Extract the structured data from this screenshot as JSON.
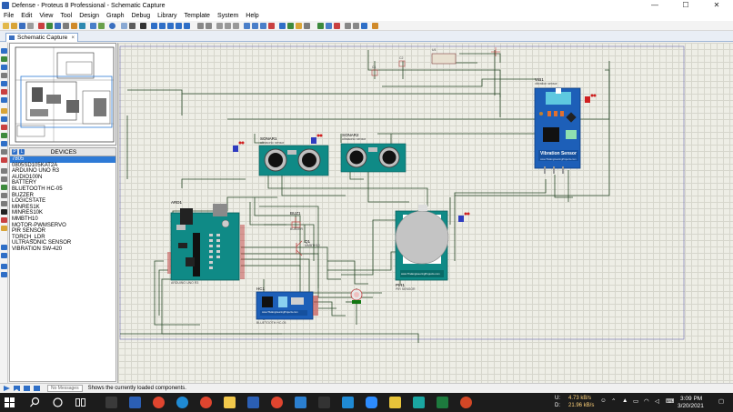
{
  "window": {
    "title": "Defense - Proteus 8 Professional - Schematic Capture",
    "controls": {
      "minimize": "—",
      "maximize": "☐",
      "close": "✕"
    }
  },
  "menu": [
    "File",
    "Edit",
    "View",
    "Tool",
    "Design",
    "Graph",
    "Debug",
    "Library",
    "Template",
    "System",
    "Help"
  ],
  "tab": {
    "label": "Schematic Capture",
    "close": "×"
  },
  "devices": {
    "header": "DEVICES",
    "pick_button": "P",
    "lib_button": "L",
    "items": [
      "7805",
      "0805SD105KAT2A",
      "ARDUINO UNO R3",
      "AUDIO100N",
      "BATTERY",
      "BLUETOOTH HC-05",
      "BUZZER",
      "LOGICSTATE",
      "MINRES1K",
      "MINRES10K",
      "MMBTH10",
      "MOTOR-PWMSERVO",
      "PIR SENSOR",
      "TORCH_LDR",
      "ULTRASONIC SENSOR",
      "VIBRATION SW-420"
    ],
    "selected_index": 0
  },
  "schematic": {
    "components": {
      "sonar1": {
        "ref": "SONAR1",
        "sub": "ultrasonic sensor"
      },
      "sonar2": {
        "ref": "SONAR2",
        "sub": "ultrasonic sensor"
      },
      "vib1": {
        "ref": "VIB1",
        "sub": "vibration sensor",
        "board_text": "Vibration Sensor",
        "site": "www.TheEngineeringProjects.com"
      },
      "ard1": {
        "ref": "ARD1",
        "sub": "ARDUINO UNO R3"
      },
      "buz1": {
        "ref": "BUZ1",
        "sub": "BUZZER"
      },
      "q1": {
        "ref": "Q1",
        "sub": "MMBTH10"
      },
      "pir1": {
        "ref": "PIR1",
        "sub": "PIR SENSOR",
        "site": "www.TheEngineeringProjects.com"
      },
      "hc1": {
        "ref": "HC1",
        "sub": "BLUETOOTH HC-05",
        "site": "www.TheEngineeringProjects.com"
      },
      "c1": {
        "ref": "C1"
      },
      "c2": {
        "ref": "C2"
      },
      "u1": {
        "ref": "U1"
      }
    }
  },
  "status": {
    "messages": "No Messages",
    "text": "Shows the currently loaded components."
  },
  "taskbar": {
    "net_up": "4.73 kB/s",
    "net_down": "21.96 kB/s",
    "up_label": "U:",
    "down_label": "D:",
    "time": "3:09 PM",
    "date": "3/20/2021"
  },
  "colors": {
    "canvas_bg": "#eeeee6",
    "wire": "#2a4a2a",
    "board_teal": "#0f8a86",
    "module_blue": "#1d5fb8",
    "selection_blue": "#2e7ad6",
    "taskbar": "#1c1c1c"
  },
  "icons": [
    "app-icon",
    "play-icon",
    "step-icon",
    "pause-icon",
    "stop-icon",
    "search-icon",
    "start-icon",
    "task-view-icon",
    "chrome-icon",
    "edge-icon",
    "explorer-icon",
    "word-icon",
    "zoom-icon",
    "excel-icon",
    "powerpoint-icon"
  ]
}
